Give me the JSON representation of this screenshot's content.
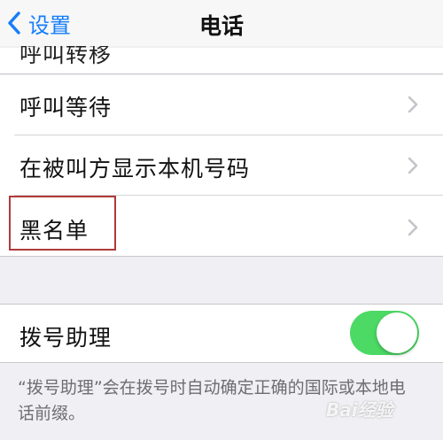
{
  "navbar": {
    "back_label": "设置",
    "title": "电话"
  },
  "rows": {
    "peek_label": "呼叫转移",
    "call_waiting": "呼叫等待",
    "show_caller_id": "在被叫方显示本机号码",
    "blacklist": "黑名单"
  },
  "dial_assist": {
    "label": "拨号助理",
    "enabled": true,
    "footnote": "“拨号助理”会在拨号时自动确定正确的国际或本地电话前缀。"
  },
  "watermark": "Bai经验",
  "colors": {
    "accent": "#157efb",
    "toggle_on": "#4cd964",
    "highlight_box": "#b03a3a",
    "background": "#efeff4"
  },
  "icons": {
    "back": "chevron-left-icon",
    "row_disclosure": "chevron-right-icon"
  }
}
